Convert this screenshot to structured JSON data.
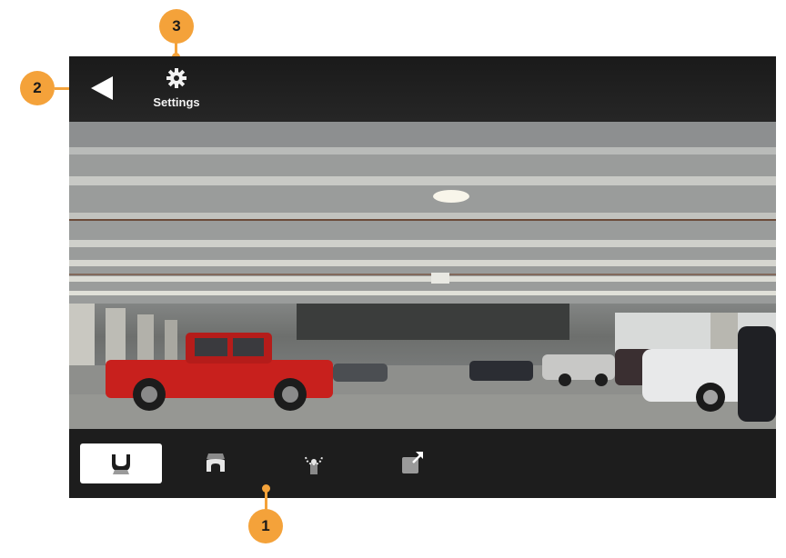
{
  "topbar": {
    "back_icon": "back-arrow-icon",
    "settings_icon": "gear-icon",
    "settings_label": "Settings"
  },
  "toolbar": {
    "views": [
      {
        "icon": "rear-view-icon",
        "active": true
      },
      {
        "icon": "front-view-icon",
        "active": false
      },
      {
        "icon": "hitch-view-icon",
        "active": false
      },
      {
        "icon": "expand-view-icon",
        "active": false
      }
    ]
  },
  "callouts": [
    "1",
    "2",
    "3"
  ],
  "colors": {
    "callout": "#f4a23a",
    "bar_bg": "#1d1d1d",
    "active_tab": "#ffffff"
  }
}
